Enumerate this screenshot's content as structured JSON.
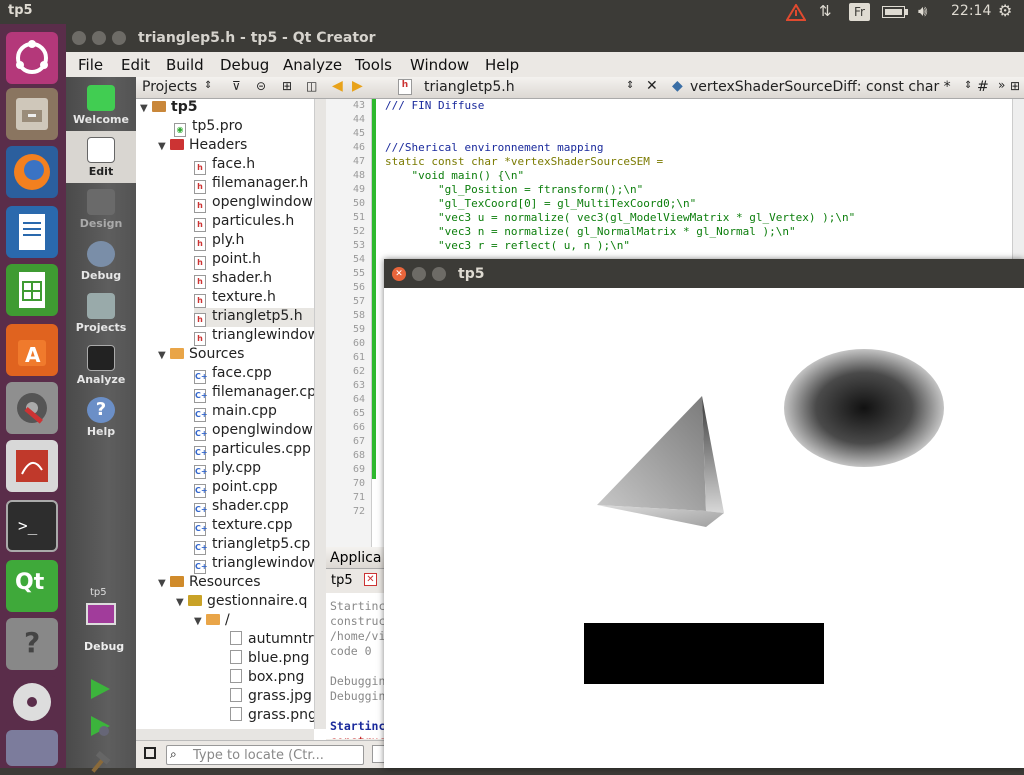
{
  "system": {
    "title": "tp5",
    "keyboard_layout": "Fr",
    "time": "22:14"
  },
  "qt": {
    "window_title": "trianglep5.h - tp5 - Qt Creator",
    "menu": [
      "File",
      "Edit",
      "Build",
      "Debug",
      "Analyze",
      "Tools",
      "Window",
      "Help"
    ],
    "modes": [
      "Welcome",
      "Edit",
      "Design",
      "Debug",
      "Projects",
      "Analyze",
      "Help"
    ],
    "target_project": "tp5",
    "target_mode": "Debug",
    "projects_label": "Projects",
    "tree": {
      "root": "tp5",
      "pro_file": "tp5.pro",
      "headers_label": "Headers",
      "headers": [
        "face.h",
        "filemanager.h",
        "openglwindow",
        "particules.h",
        "ply.h",
        "point.h",
        "shader.h",
        "texture.h",
        "triangletp5.h",
        "trianglewindow"
      ],
      "sources_label": "Sources",
      "sources": [
        "face.cpp",
        "filemanager.cp",
        "main.cpp",
        "openglwindow",
        "particules.cpp",
        "ply.cpp",
        "point.cpp",
        "shader.cpp",
        "texture.cpp",
        "triangletp5.cp",
        "trianglewindow"
      ],
      "resources_label": "Resources",
      "qrc": "gestionnaire.q",
      "prefix": "/",
      "resource_files": [
        "autumntr",
        "blue.png",
        "box.png",
        "grass.jpg",
        "grass.png"
      ]
    },
    "editor": {
      "file_tab": "triangletp5.h",
      "symbol": "vertexShaderSourceDiff: const char *",
      "hash": "#",
      "line_numbers": [
        "43",
        "44",
        "45",
        "46",
        "47",
        "48",
        "49",
        "50",
        "51",
        "52",
        "53",
        "54",
        "55",
        "56",
        "57",
        "58",
        "59",
        "60",
        "61",
        "62",
        "63",
        "64",
        "65",
        "66",
        "67",
        "68",
        "69",
        "70",
        "71",
        "72"
      ],
      "lines": [
        "/// FIN Diffuse",
        "",
        "",
        "///Sherical environnement mapping",
        "static const char *vertexShaderSourceSEM =",
        "    \"void main() {\\n\"",
        "        \"gl_Position = ftransform();\\n\"",
        "        \"gl_TexCoord[0] = gl_MultiTexCoord0;\\n\"",
        "        \"vec3 u = normalize( vec3(gl_ModelViewMatrix * gl_Vertex) );\\n\"",
        "        \"vec3 n = normalize( gl_NormalMatrix * gl_Normal );\\n\"",
        "        \"vec3 r = reflect( u, n );\\n\""
      ]
    },
    "output": {
      "header": "Applica",
      "tab": "tp5",
      "lines": [
        "Startinc",
        "construc",
        "/home/vi",
        "code 0",
        "",
        "Debuggin",
        "Debuggin",
        "",
        "Startinc",
        "construc"
      ]
    },
    "locator_placeholder": "Type to locate (Ctr..."
  },
  "gl": {
    "window_title": "tp5"
  },
  "colors": {
    "launcher": "#5a2d4a",
    "topbar": "#3c3b37",
    "accent": "#dd4814"
  }
}
